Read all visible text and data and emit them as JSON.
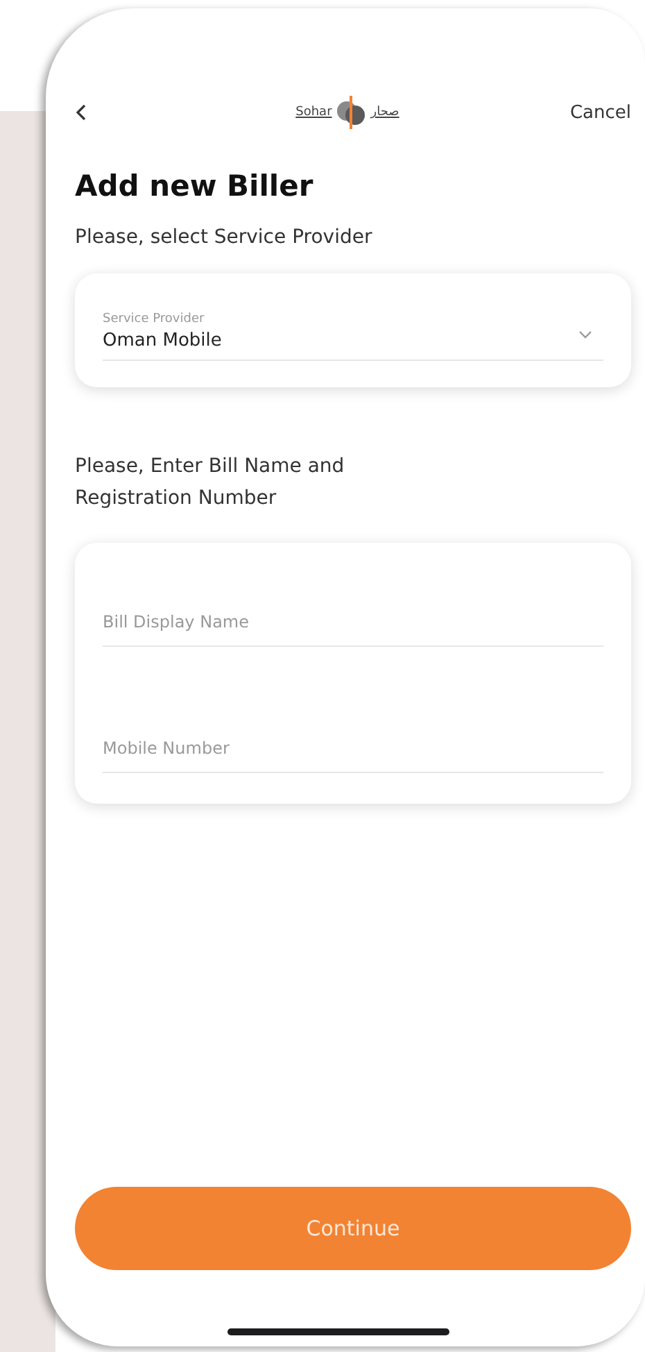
{
  "header": {
    "logo": {
      "latin": "Sohar",
      "arabic": "صحار"
    },
    "cancel": "Cancel"
  },
  "title": "Add new Biller",
  "provider_section": {
    "prompt": "Please, select Service Provider",
    "select": {
      "label": "Service Provider",
      "value": "Oman Mobile"
    }
  },
  "bill_section": {
    "prompt": "Please, Enter Bill Name and Registration Number",
    "fields": [
      {
        "placeholder": "Bill Display Name"
      },
      {
        "placeholder": "Mobile Number"
      }
    ]
  },
  "button": "Continue"
}
